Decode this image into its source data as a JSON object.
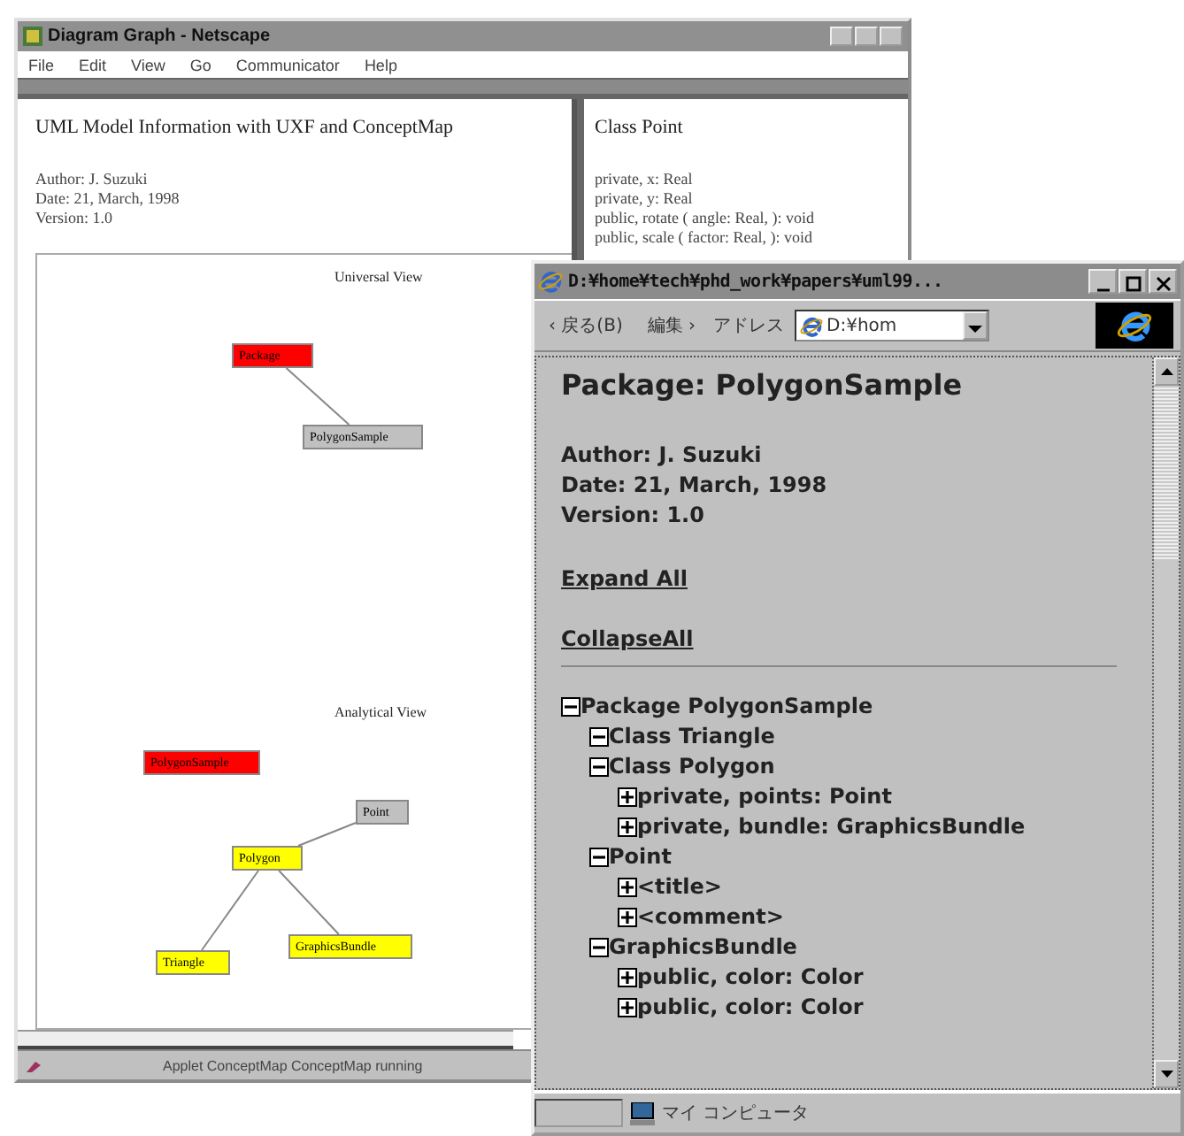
{
  "back_window": {
    "title": "Diagram Graph - Netscape",
    "menu": [
      "File",
      "Edit",
      "View",
      "Go",
      "Communicator",
      "Help"
    ],
    "left_frame": {
      "heading": "UML Model Information with UXF and ConceptMap",
      "lines": [
        "Author: J. Suzuki",
        "Date: 21, March, 1998",
        "Version: 1.0"
      ],
      "views": [
        {
          "title": "Universal View",
          "nodes": [
            {
              "label": "Package",
              "color": "#ff0000",
              "children": [
                {
                  "label": "PolygonSample",
                  "color": "#c0c0c0"
                }
              ]
            }
          ]
        },
        {
          "title": "Analytical View",
          "nodes": [
            {
              "label": "PolygonSample",
              "color": "#ff0000"
            },
            {
              "label": "Polygon",
              "color": "#ffff00",
              "children": [
                {
                  "label": "Point",
                  "color": "#c0c0c0"
                },
                {
                  "label": "Triangle",
                  "color": "#ffff00"
                },
                {
                  "label": "GraphicsBundle",
                  "color": "#ffff00"
                }
              ]
            }
          ]
        }
      ]
    },
    "right_frame": {
      "heading": "Class Point",
      "lines": [
        "private, x: Real",
        "private, y: Real",
        "public, rotate ( angle: Real, ): void",
        "public, scale ( factor: Real, ): void"
      ]
    },
    "status_bar": "Applet ConceptMap ConceptMap running"
  },
  "front_window": {
    "title": "D:¥home¥tech¥phd_work¥papers¥uml99...",
    "toolbar": {
      "back": "‹ 戻る(B)",
      "edit": "編集 ›",
      "address_label": "アドレス",
      "address": "D:¥hom"
    },
    "heading": "Package: PolygonSample",
    "lines": [
      "Author: J. Suzuki",
      "Date: 21, March, 1998",
      "Version: 1.0"
    ],
    "links": [
      "Expand All",
      "CollapseAll"
    ],
    "tree": [
      {
        "label": "Package PolygonSample",
        "expanded": true,
        "children": [
          {
            "label": "Class Triangle",
            "expanded": true
          },
          {
            "label": "Class Polygon",
            "expanded": true,
            "children": [
              {
                "label": "private, points: Point",
                "expanded": false
              },
              {
                "label": "private, bundle: GraphicsBundle",
                "expanded": false
              }
            ]
          },
          {
            "label": "Point",
            "expanded": true,
            "children": [
              {
                "label": "<title>",
                "expanded": false
              },
              {
                "label": "<comment>",
                "expanded": false
              }
            ]
          },
          {
            "label": "GraphicsBundle",
            "expanded": true,
            "children": [
              {
                "label": "public, color: Color",
                "expanded": false
              },
              {
                "label": "public, color: Color",
                "expanded": false
              }
            ]
          }
        ]
      }
    ],
    "status_bar": "マイ コンピュータ"
  }
}
